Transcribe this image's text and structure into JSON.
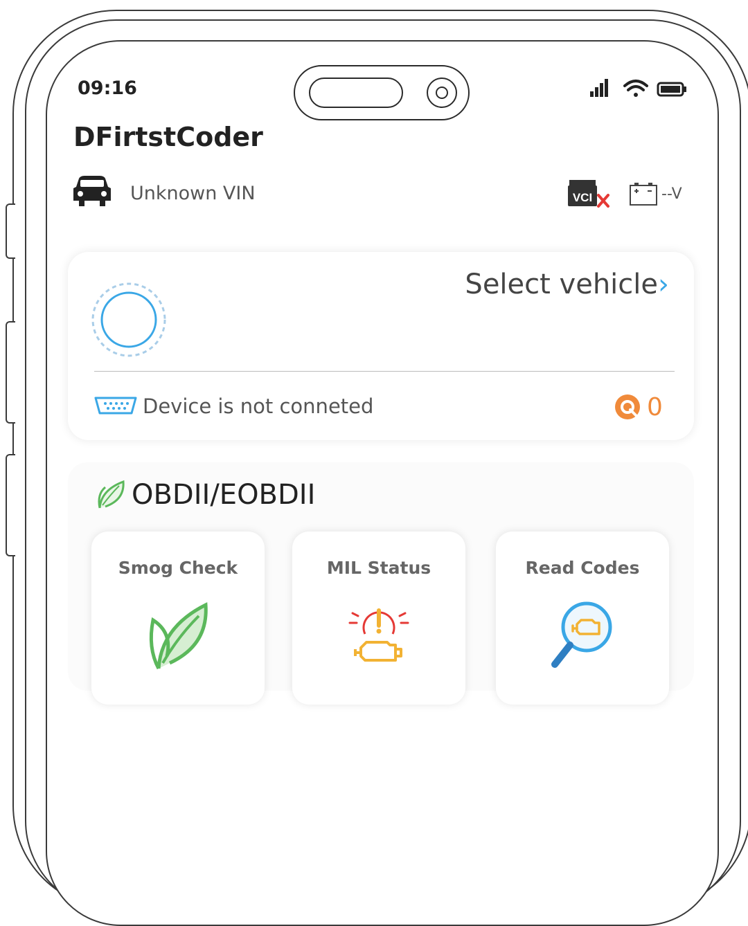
{
  "status_bar": {
    "time": "09:16"
  },
  "header": {
    "app_title": "DFirtstCoder"
  },
  "vehicle_info": {
    "vin": "Unknown VIN",
    "vci_label": "VCI",
    "voltage": "--V"
  },
  "connection_card": {
    "select_vehicle": "Select vehicle",
    "chevron": "›",
    "device_status": "Device is not conneted",
    "count": "0"
  },
  "obd_section": {
    "title": "OBDII/EOBDII",
    "tiles": [
      {
        "label": "Smog Check",
        "icon": "leaf-icon"
      },
      {
        "label": "MIL Status",
        "icon": "engine-warning-icon"
      },
      {
        "label": "Read Codes",
        "icon": "engine-search-icon"
      }
    ]
  },
  "colors": {
    "accent_blue": "#3aa7e6",
    "accent_orange": "#f08a3a",
    "accent_green": "#5bb85b",
    "warning_red": "#e53935"
  }
}
